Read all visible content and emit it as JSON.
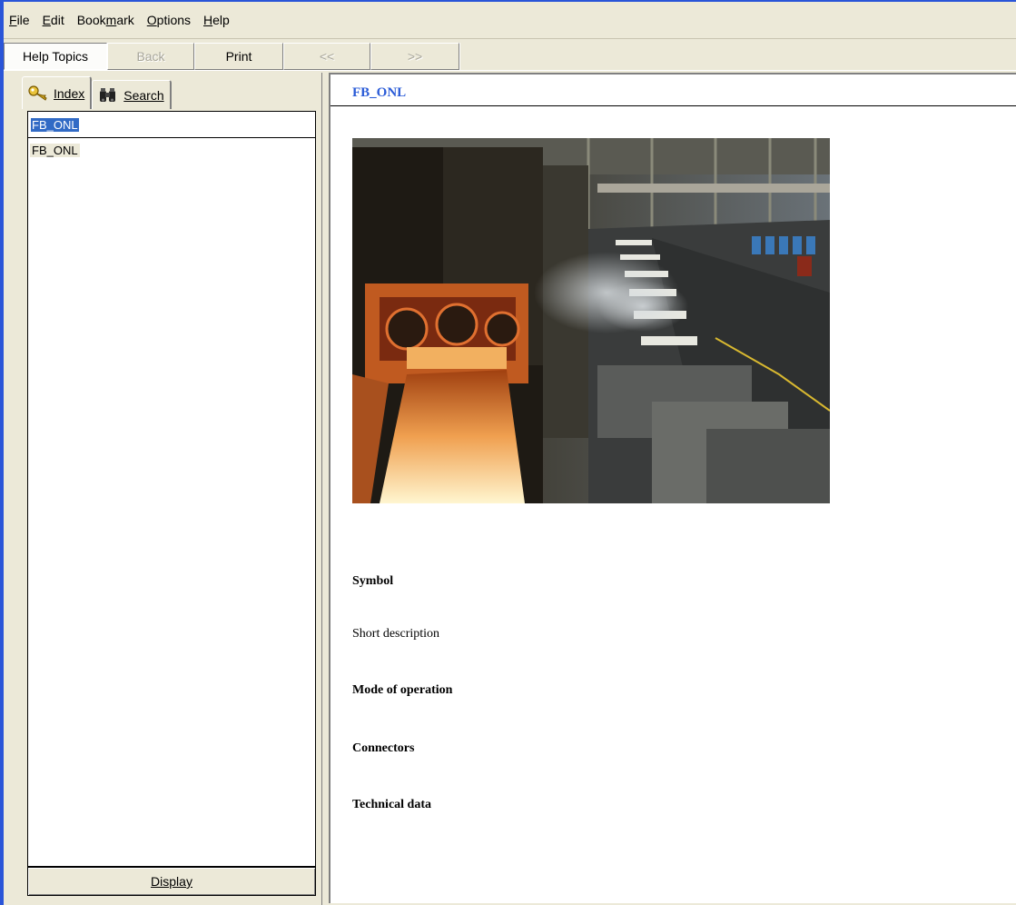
{
  "menu": {
    "items": [
      {
        "accel": "F",
        "rest": "ile"
      },
      {
        "accel": "E",
        "rest": "dit"
      },
      {
        "pre": "Book",
        "accel": "m",
        "rest": "ark"
      },
      {
        "accel": "O",
        "rest": "ptions"
      },
      {
        "accel": "H",
        "rest": "elp"
      }
    ]
  },
  "toolbar": {
    "help_topics": "Help Topics",
    "back": "Back",
    "print": "Print",
    "prev": "<<",
    "next": ">>"
  },
  "tabs": {
    "index": "Index",
    "search": "Search"
  },
  "index": {
    "input_value": "FB_ONL",
    "entries": [
      "FB_ONL"
    ],
    "display_button": "Display"
  },
  "topic": {
    "title": "FB_ONL",
    "sections": {
      "symbol": "Symbol",
      "short_description": "Short description",
      "mode": "Mode of operation",
      "connectors": "Connectors",
      "technical": "Technical data"
    }
  },
  "colors": {
    "window_frame": "#2a55d8",
    "title_link": "#2a5bd7",
    "selection": "#316ac5",
    "chrome": "#ece9d8"
  },
  "icons": {
    "index_tab": "key-icon",
    "search_tab": "binoculars-icon"
  }
}
